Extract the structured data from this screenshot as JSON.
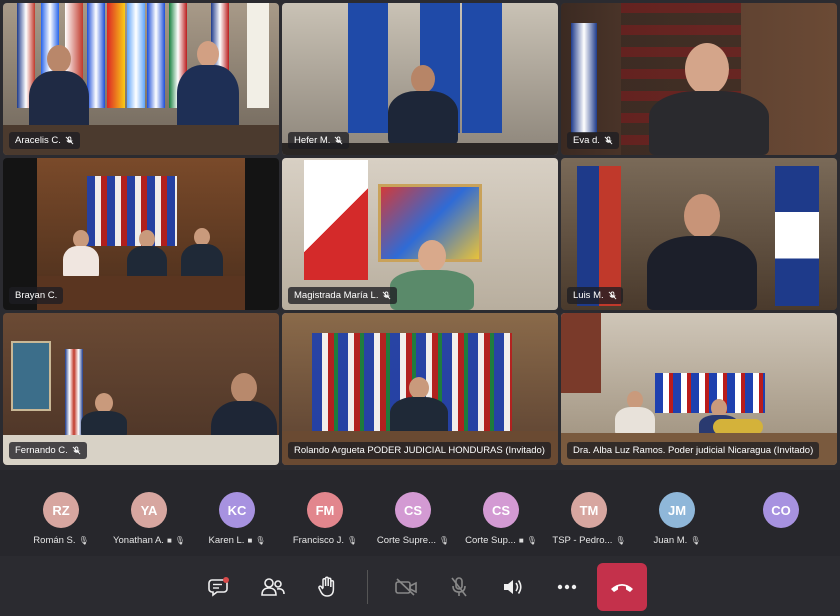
{
  "video_tiles": [
    {
      "name": "Aracelis C."
    },
    {
      "name": "Hefer M."
    },
    {
      "name": "Eva d."
    },
    {
      "name": "Brayan C."
    },
    {
      "name": "Magistrada María L."
    },
    {
      "name": "Luis M."
    },
    {
      "name": "Fernando C."
    },
    {
      "name": "Rolando Argueta PODER JUDICIAL HONDURAS (Invitado)"
    },
    {
      "name": "Dra. Alba Luz Ramos. Poder judicial Nicaragua (Invitado)"
    }
  ],
  "participants": [
    {
      "initials": "RZ",
      "name": "Román S.",
      "color": "#d7a6a0"
    },
    {
      "initials": "YA",
      "name": "Yonathan A.",
      "color": "#d7a6a0"
    },
    {
      "initials": "KC",
      "name": "Karen L.",
      "color": "#a792e0"
    },
    {
      "initials": "FM",
      "name": "Francisco J.",
      "color": "#e2868d"
    },
    {
      "initials": "CS",
      "name": "Corte Supre...",
      "color": "#d39ad3"
    },
    {
      "initials": "CS",
      "name": "Corte Sup...",
      "color": "#d39ad3"
    },
    {
      "initials": "TM",
      "name": "TSP - Pedro...",
      "color": "#d7a6a0"
    },
    {
      "initials": "JM",
      "name": "Juan M.",
      "color": "#8fb7d9"
    },
    {
      "initials": "CO",
      "name": "",
      "color": "#a792e0"
    }
  ],
  "toolbar": {
    "chat": "chat-icon",
    "participants": "people-icon",
    "raise_hand": "raise-hand-icon",
    "camera": "camera-off-icon",
    "mic": "mic-off-icon",
    "speaker": "speaker-icon",
    "more": "more-icon",
    "hangup": "hang-up-icon"
  },
  "colors": {
    "hangup": "#c4314b",
    "active_border": "#8f8fd8"
  }
}
